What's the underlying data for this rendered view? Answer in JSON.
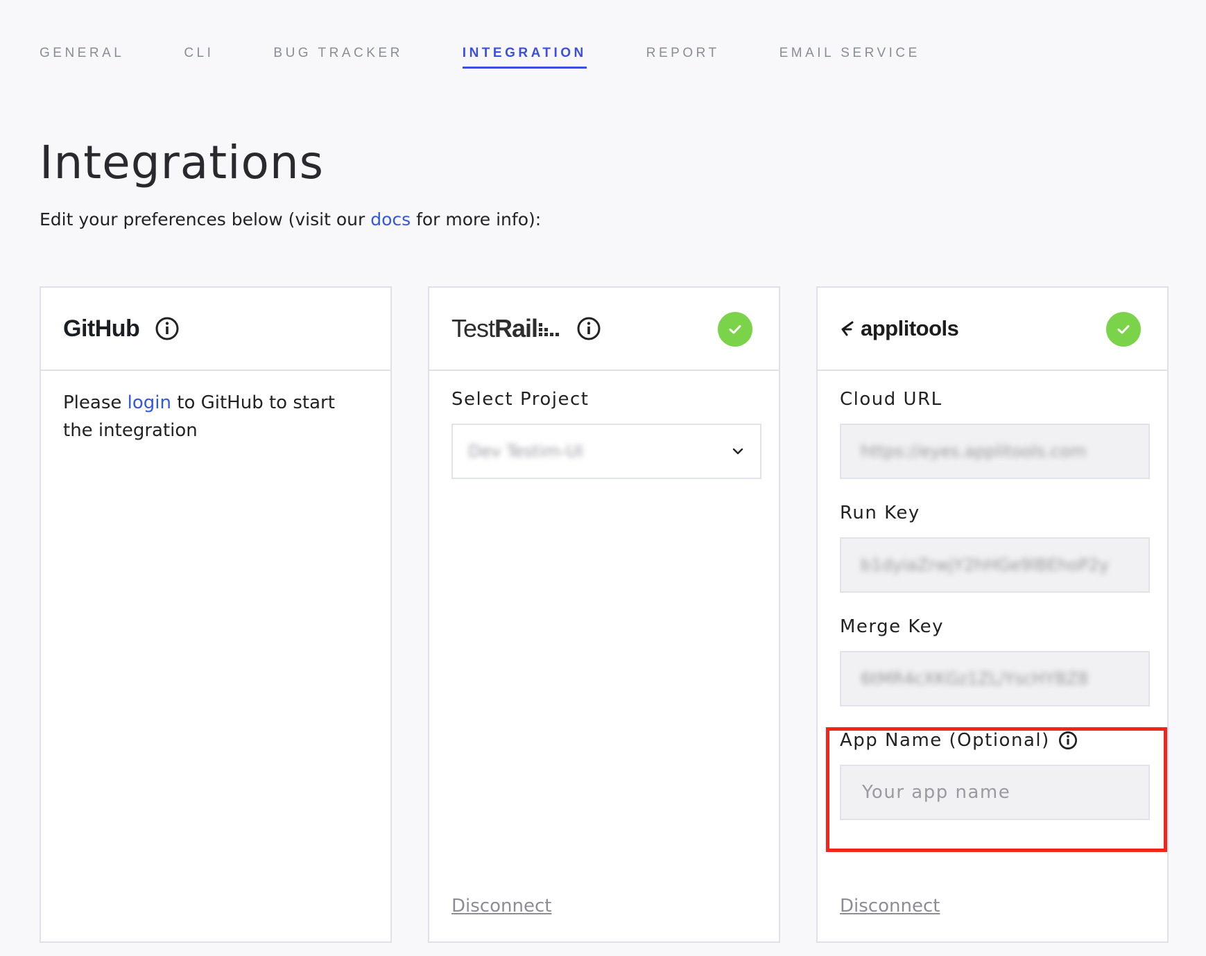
{
  "tabs": [
    {
      "label": "GENERAL"
    },
    {
      "label": "CLI"
    },
    {
      "label": "BUG TRACKER"
    },
    {
      "label": "INTEGRATION"
    },
    {
      "label": "REPORT"
    },
    {
      "label": "EMAIL SERVICE"
    }
  ],
  "active_tab": "INTEGRATION",
  "page": {
    "title": "Integrations",
    "subtitle_before": "Edit your preferences below (visit our ",
    "subtitle_link": "docs",
    "subtitle_after": " for more info):"
  },
  "github": {
    "logo_text": "GitHub",
    "icon": "info-icon",
    "text_before": "Please ",
    "link": "login",
    "text_after": " to GitHub to start the integration"
  },
  "testrail": {
    "logo_text_light": "Test",
    "logo_text_bold": "Rail",
    "icon": "info-icon",
    "connected_icon": "check-icon",
    "select_label": "Select Project",
    "select_value": "Dev Testim-UI",
    "dropdown_icon": "chevron-down-icon",
    "disconnect_label": "Disconnect"
  },
  "applitools": {
    "logo_text": "applitools",
    "connected_icon": "check-icon",
    "cloud_url_label": "Cloud URL",
    "cloud_url_value": "https://eyes.applitools.com",
    "run_key_label": "Run Key",
    "run_key_value": "b1dyiaZrwjY2hHGe9lBEhoP2y",
    "merge_key_label": "Merge Key",
    "merge_key_value": "6tMR4cXKGz1ZL/YscHYBZ8",
    "app_name_label": "App Name (Optional)",
    "app_name_icon": "info-icon",
    "app_name_placeholder": "Your app name",
    "disconnect_label": "Disconnect"
  },
  "colors": {
    "accent": "#3b4fe0",
    "link": "#3556e0",
    "success": "#7ad348",
    "highlight": "#f2241b"
  }
}
